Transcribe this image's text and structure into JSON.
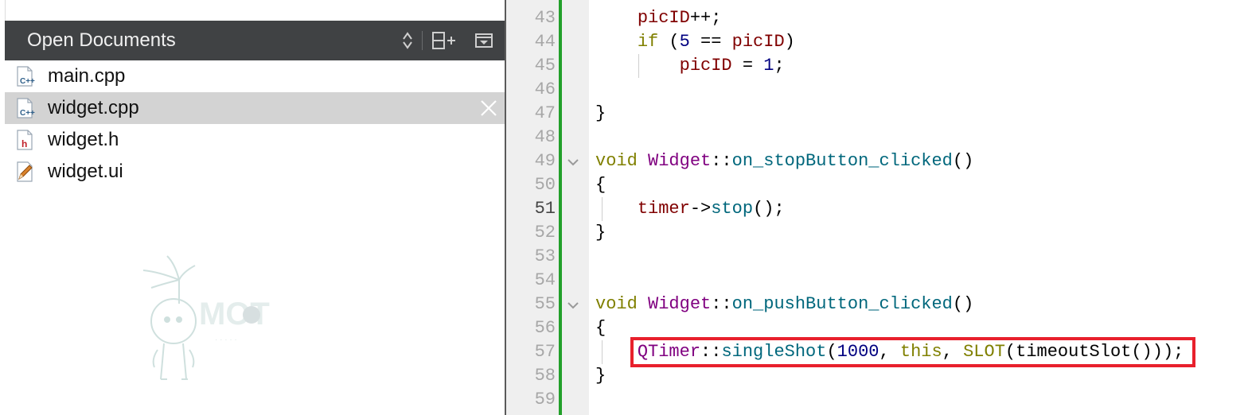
{
  "sidebar": {
    "title": "Open Documents",
    "documents": [
      {
        "name": "main.cpp",
        "icon": "cpp-file-icon",
        "selected": false
      },
      {
        "name": "widget.cpp",
        "icon": "cpp-file-icon",
        "selected": true
      },
      {
        "name": "widget.h",
        "icon": "header-file-icon",
        "selected": false
      },
      {
        "name": "widget.ui",
        "icon": "ui-form-file-icon",
        "selected": false
      }
    ],
    "watermark_text": "MOT"
  },
  "editor": {
    "current_line": "51",
    "lines": [
      {
        "num": "43",
        "tokens": [
          {
            "t": "    "
          },
          {
            "t": "picID",
            "c": "var"
          },
          {
            "t": "++;"
          }
        ]
      },
      {
        "num": "44",
        "tokens": [
          {
            "t": "    "
          },
          {
            "t": "if",
            "c": "kw"
          },
          {
            "t": " ("
          },
          {
            "t": "5",
            "c": "num"
          },
          {
            "t": " == "
          },
          {
            "t": "picID",
            "c": "var"
          },
          {
            "t": ")"
          }
        ]
      },
      {
        "num": "45",
        "tokens": [
          {
            "t": "        "
          },
          {
            "t": "picID",
            "c": "var"
          },
          {
            "t": " = "
          },
          {
            "t": "1",
            "c": "num"
          },
          {
            "t": ";"
          }
        ]
      },
      {
        "num": "46",
        "tokens": []
      },
      {
        "num": "47",
        "tokens": [
          {
            "t": "}"
          }
        ]
      },
      {
        "num": "48",
        "tokens": []
      },
      {
        "num": "49",
        "fold": true,
        "tokens": [
          {
            "t": "void",
            "c": "kw"
          },
          {
            "t": " "
          },
          {
            "t": "Widget",
            "c": "cls"
          },
          {
            "t": "::"
          },
          {
            "t": "on_stopButton_clicked",
            "c": "fn"
          },
          {
            "t": "()"
          }
        ]
      },
      {
        "num": "50",
        "tokens": [
          {
            "t": "{"
          }
        ]
      },
      {
        "num": "51",
        "tokens": [
          {
            "t": "    "
          },
          {
            "t": "timer",
            "c": "var"
          },
          {
            "t": "->"
          },
          {
            "t": "stop",
            "c": "fn"
          },
          {
            "t": "();"
          }
        ]
      },
      {
        "num": "52",
        "tokens": [
          {
            "t": "}"
          }
        ]
      },
      {
        "num": "53",
        "tokens": []
      },
      {
        "num": "54",
        "tokens": []
      },
      {
        "num": "55",
        "fold": true,
        "tokens": [
          {
            "t": "void",
            "c": "kw"
          },
          {
            "t": " "
          },
          {
            "t": "Widget",
            "c": "cls"
          },
          {
            "t": "::"
          },
          {
            "t": "on_pushButton_clicked",
            "c": "fn"
          },
          {
            "t": "()"
          }
        ]
      },
      {
        "num": "56",
        "tokens": [
          {
            "t": "{"
          }
        ]
      },
      {
        "num": "57",
        "tokens": [
          {
            "t": "    "
          },
          {
            "t": "QTimer",
            "c": "cls"
          },
          {
            "t": "::"
          },
          {
            "t": "singleShot",
            "c": "fn"
          },
          {
            "t": "("
          },
          {
            "t": "1000",
            "c": "num"
          },
          {
            "t": ", "
          },
          {
            "t": "this",
            "c": "kw"
          },
          {
            "t": ", "
          },
          {
            "t": "SLOT",
            "c": "kw"
          },
          {
            "t": "(timeoutSlot()));"
          }
        ]
      },
      {
        "num": "58",
        "tokens": [
          {
            "t": "}"
          }
        ]
      },
      {
        "num": "59",
        "tokens": []
      }
    ]
  },
  "colors": {
    "header_bg": "#404244",
    "selected_row": "#d3d3d3",
    "modified_bar": "#22a02a",
    "highlight_box": "#e8202c"
  }
}
